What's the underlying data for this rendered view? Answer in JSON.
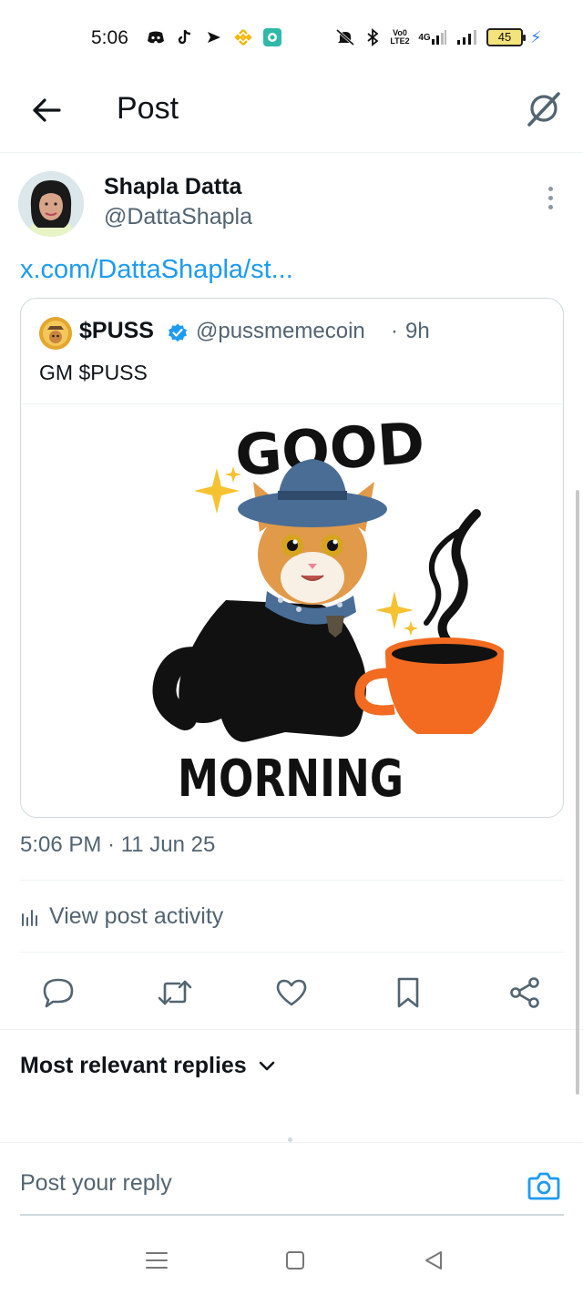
{
  "status_bar": {
    "time": "5:06",
    "left_icons": [
      "discord-icon",
      "tiktok-icon",
      "send-icon",
      "binance-icon",
      "app-icon"
    ],
    "right_icons": [
      "mute-icon",
      "bluetooth-icon",
      "volte-icon",
      "4g-signal-icon",
      "signal-icon"
    ],
    "volte_text": "Vo0 LTE2",
    "network_text": "4G",
    "battery_level": "45"
  },
  "header": {
    "title": "Post"
  },
  "post": {
    "author_name": "Shapla Datta",
    "author_handle": "@DattaShapla",
    "link_text": "x.com/DattaShapla/st...",
    "timestamp": "5:06 PM · 11 Jun 25",
    "activity_label": "View post activity"
  },
  "quote": {
    "name": "$PUSS",
    "handle": "@pussmemecoin",
    "separator": "·",
    "time": "9h",
    "text": "GM $PUSS",
    "image": {
      "line_top": "GOOD",
      "line_bottom": "MORNING"
    }
  },
  "actions": [
    "reply-icon",
    "repost-icon",
    "like-icon",
    "bookmark-icon",
    "share-icon"
  ],
  "replies": {
    "sort_label": "Most relevant replies"
  },
  "reply_box": {
    "placeholder": "Post your reply"
  },
  "colors": {
    "accent": "#1d9bf0",
    "text_primary": "#0f1419",
    "text_secondary": "#536471",
    "border": "#cfd9de",
    "mug_orange": "#f26b21",
    "hat_blue": "#4a6d96"
  }
}
